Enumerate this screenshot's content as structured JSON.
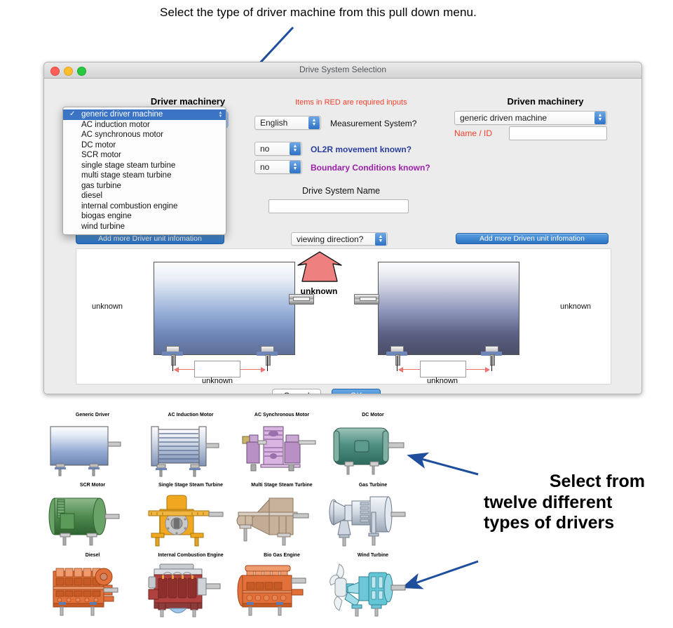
{
  "annotations": {
    "top": "Select the type of driver machine from this pull down menu.",
    "bottom_lines": [
      "Select from",
      "twelve different",
      "types of drivers"
    ],
    "arrow_color": "#1f4e9c"
  },
  "window": {
    "title": "Drive System Selection",
    "traffic_lights": [
      "close",
      "minimize",
      "maximize"
    ]
  },
  "form": {
    "driver_header": "Driver machinery",
    "driven_header": "Driven machinery",
    "red_note": "Items in RED are required inputs",
    "measurement": {
      "value": "English",
      "label": "Measurement System?"
    },
    "ol2r": {
      "value": "no",
      "label": "OL2R movement known?"
    },
    "boundary": {
      "value": "no",
      "label": "Boundary Conditions known?"
    },
    "drive_system_name": {
      "label": "Drive System Name",
      "value": ""
    },
    "driven_machine": {
      "value": "generic driven machine"
    },
    "driven_name_id": {
      "label": "Name / ID",
      "value": ""
    },
    "viewing_direction": {
      "value": "viewing direction?"
    },
    "add_driver_button": "Add more Driver unit infomation",
    "add_driven_button": "Add more Driven unit infomation",
    "cancel_button": "Cancel",
    "ok_button": "OK"
  },
  "dropdown": {
    "selected_index": 0,
    "items": [
      "generic driver machine",
      "AC induction motor",
      "AC synchronous motor",
      "DC motor",
      "SCR motor",
      "single stage steam turbine",
      "multi stage steam turbine",
      "gas turbine",
      "diesel",
      "internal combustion engine",
      "biogas engine",
      "wind turbine"
    ],
    "check_glyph": "✓",
    "highlight_color": "#3b74c4"
  },
  "diagram": {
    "left_side_label": "unknown",
    "right_side_label": "unknown",
    "arrow_label": "unknown",
    "left_dim_label": "unknown",
    "right_dim_label": "unknown",
    "arrow_color": "#ef8080"
  },
  "gallery": {
    "items": [
      {
        "caption": "Generic Driver",
        "color": "#8fa9d4"
      },
      {
        "caption": "AC Induction Motor",
        "color": "#9aadcd"
      },
      {
        "caption": "AC Synchronous Motor",
        "color": "#c49ecb"
      },
      {
        "caption": "DC Motor",
        "color": "#4f9184"
      },
      {
        "caption": "SCR Motor",
        "color": "#4e8a4e"
      },
      {
        "caption": "Single Stage Steam Turbine",
        "color": "#efa820"
      },
      {
        "caption": "Multi Stage Steam Turbine",
        "color": "#c3ab95"
      },
      {
        "caption": "Gas Turbine",
        "color": "#cfd8e2"
      },
      {
        "caption": "Diesel",
        "color": "#e2703a"
      },
      {
        "caption": "Internal Combustion Engine",
        "color": "#b0413f"
      },
      {
        "caption": "Bio Gas Engine",
        "color": "#e2703a"
      },
      {
        "caption": "Wind Turbine",
        "color": "#63c6d6"
      }
    ]
  }
}
